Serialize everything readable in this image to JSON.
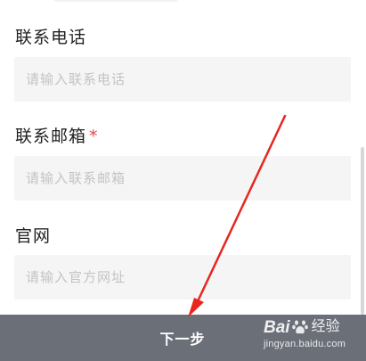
{
  "form": {
    "fields": [
      {
        "label": "联系电话",
        "required": false,
        "placeholder": "请输入联系电话",
        "value": ""
      },
      {
        "label": "联系邮箱",
        "required": true,
        "required_mark": "*",
        "placeholder": "请输入联系邮箱",
        "value": ""
      },
      {
        "label": "官网",
        "required": false,
        "placeholder": "请输入官方网址",
        "value": ""
      }
    ]
  },
  "footer": {
    "next_label": "下一步"
  },
  "watermark": {
    "brand_prefix": "Bai",
    "brand_suffix": "经验",
    "url": "jingyan.baidu.com",
    "logo_icon": "baidu-paw-icon"
  },
  "annotation": {
    "arrow_color": "#e8261f",
    "arrow_icon": "red-pointer-arrow"
  },
  "colors": {
    "required": "#e5484d",
    "input_bg": "#f5f5f5",
    "bottom_bar": "#6b6f78"
  }
}
